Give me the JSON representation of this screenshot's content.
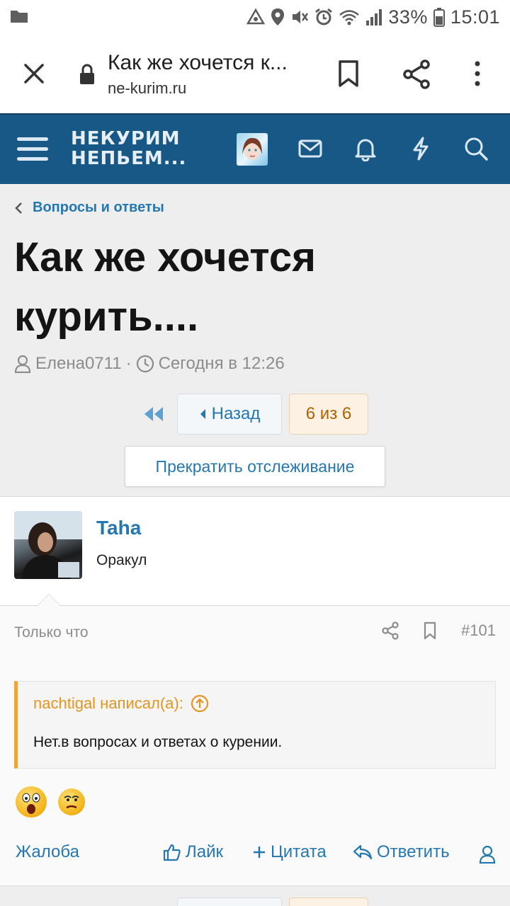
{
  "status_bar": {
    "battery_percent": "33%",
    "time": "15:01"
  },
  "browser_bar": {
    "page_title": "Как же хочется к...",
    "url": "ne-kurim.ru"
  },
  "site_header": {
    "logo_line1": "НЕКУРИМ",
    "logo_line2": "НЕПЬЕМ..."
  },
  "thread": {
    "breadcrumb": "Вопросы и ответы",
    "title": "Как же хочется курить....",
    "author": "Елена0711",
    "separator": "·",
    "date": "Сегодня в 12:26",
    "pager_back": "Назад",
    "pager_count": "6 из 6",
    "watch_button": "Прекратить отслеживание"
  },
  "post": {
    "username": "Taha",
    "user_title": "Оракул",
    "time": "Только что",
    "number": "#101",
    "quote_author": "nachtigal написал(а):",
    "quote_text": "Нет.в вопросах и ответах о курении.",
    "actions": {
      "report": "Жалоба",
      "like": "Лайк",
      "quote": "Цитата",
      "reply": "Ответить"
    }
  },
  "colors": {
    "header_bg": "#185886",
    "link": "#2577b1",
    "quote_accent": "#f0a33a",
    "page_bg": "#eeeeee"
  }
}
